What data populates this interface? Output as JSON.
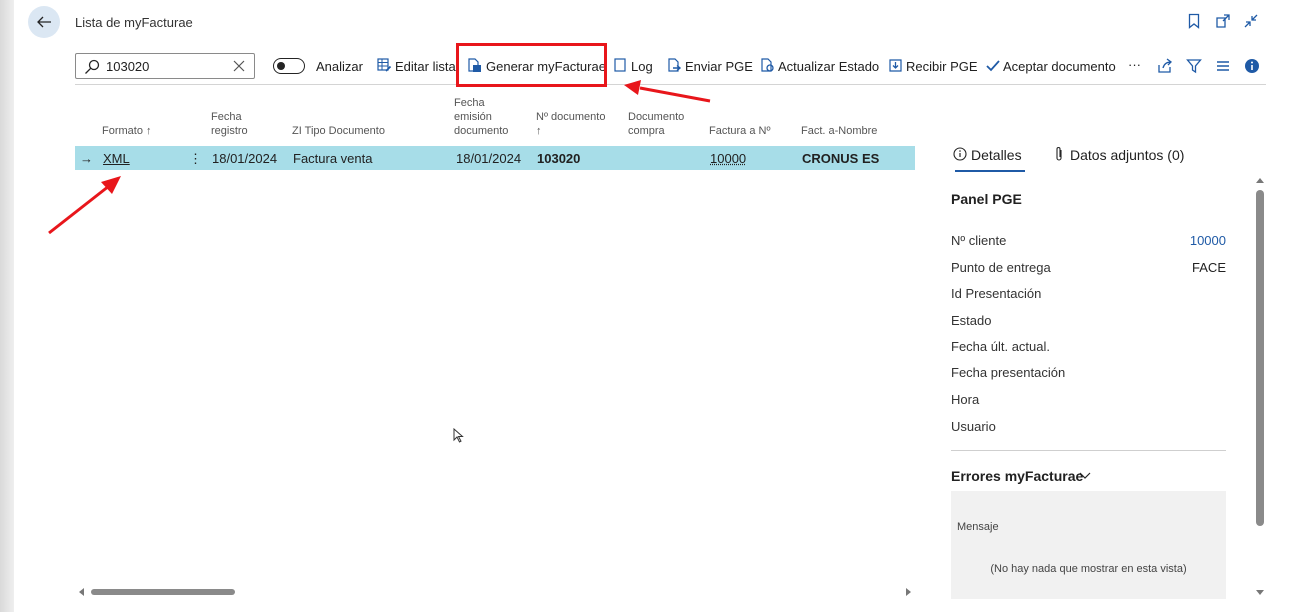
{
  "page": {
    "title": "Lista de myFacturae"
  },
  "search": {
    "value": "103020"
  },
  "toolbar": {
    "analizar": "Analizar",
    "editar_lista": "Editar lista",
    "generar": "Generar myFacturae",
    "log": "Log",
    "enviar_pge": "Enviar PGE",
    "actualizar_estado": "Actualizar Estado",
    "recibir_pge": "Recibir PGE",
    "aceptar": "Aceptar documento",
    "more": "···"
  },
  "columns": {
    "formato": "Formato ↑",
    "fecha_registro_1": "Fecha",
    "fecha_registro_2": "registro",
    "tipo_documento": "ZI Tipo Documento",
    "fecha_emision_1": "Fecha",
    "fecha_emision_2": "emisión",
    "fecha_emision_3": "documento",
    "n_documento_1": "Nº documento",
    "n_documento_2": "↑",
    "doc_compra_1": "Documento",
    "doc_compra_2": "compra",
    "factura_a": "Factura a Nº",
    "fact_nombre": "Fact. a-Nombre"
  },
  "row": {
    "arrow": "→",
    "formato": "XML",
    "menu": "⋮",
    "fecha_registro": "18/01/2024",
    "tipo_documento": "Factura venta",
    "fecha_emision": "18/01/2024",
    "n_documento": "103020",
    "factura_a": "10000",
    "fact_nombre": "CRONUS ES"
  },
  "panel": {
    "tab_detalles": "Detalles",
    "tab_adjuntos": "Datos adjuntos (0)",
    "section_title": "Panel PGE",
    "fields": [
      {
        "label": "Nº cliente",
        "value": "10000"
      },
      {
        "label": "Punto de entrega",
        "value": "FACE"
      },
      {
        "label": "Id Presentación",
        "value": ""
      },
      {
        "label": "Estado",
        "value": ""
      },
      {
        "label": "Fecha últ. actual.",
        "value": ""
      },
      {
        "label": "Fecha presentación",
        "value": ""
      },
      {
        "label": "Hora",
        "value": ""
      },
      {
        "label": "Usuario",
        "value": ""
      }
    ],
    "errors_title": "Errores myFacturae",
    "errors_column": "Mensaje",
    "errors_empty": "(No hay nada que mostrar en esta vista)"
  },
  "colors": {
    "selected_row": "#a7dde8",
    "link": "#1f5aa6",
    "highlight": "#e8161b"
  }
}
